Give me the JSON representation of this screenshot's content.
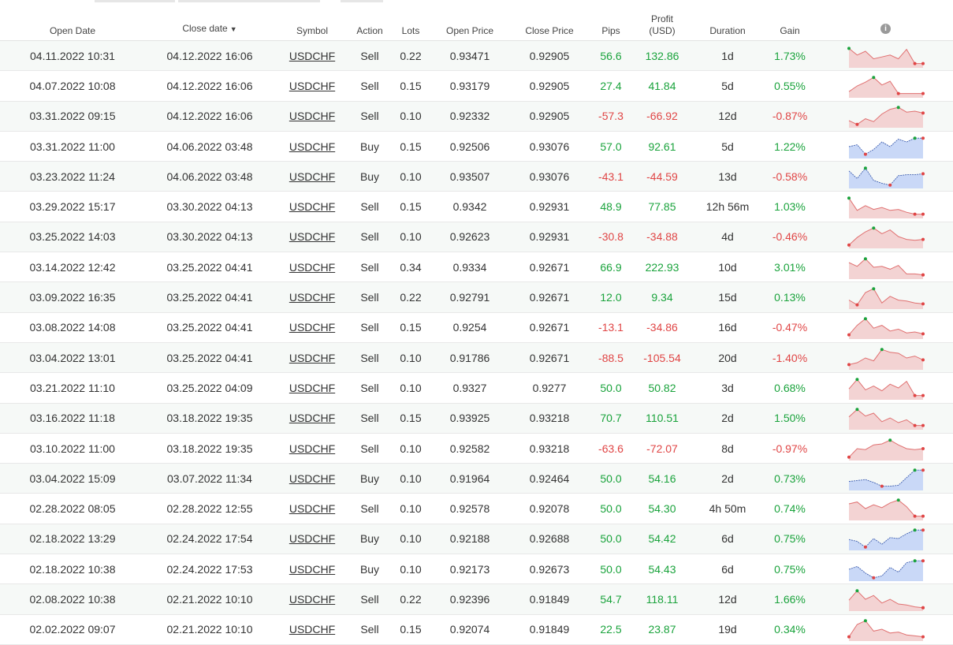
{
  "headers": {
    "open_date": "Open Date",
    "close_date": "Close date",
    "sort_arrow": "▼",
    "symbol": "Symbol",
    "action": "Action",
    "lots": "Lots",
    "open_price": "Open Price",
    "close_price": "Close Price",
    "pips": "Pips",
    "profit_line1": "Profit",
    "profit_line2": "(USD)",
    "duration": "Duration",
    "gain": "Gain",
    "info_glyph": "i"
  },
  "colors": {
    "positive": "#1aa33c",
    "negative": "#e04545",
    "sell_fill": "#f3d3d3",
    "sell_line": "#e07070",
    "buy_fill": "#c9d8f7",
    "buy_line": "#4060b0"
  },
  "rows": [
    {
      "open": "04.11.2022 10:31",
      "close": "04.12.2022 16:06",
      "symbol": "USDCHF",
      "action": "Sell",
      "lots": "0.22",
      "open_price": "0.93471",
      "close_price": "0.92905",
      "pips": "56.6",
      "profit": "132.86",
      "duration": "1d",
      "gain": "1.73%",
      "spark": [
        0.9,
        0.55,
        0.75,
        0.35,
        0.45,
        0.55,
        0.35,
        0.85,
        0.1,
        0.1
      ]
    },
    {
      "open": "04.07.2022 10:08",
      "close": "04.12.2022 16:06",
      "symbol": "USDCHF",
      "action": "Sell",
      "lots": "0.15",
      "open_price": "0.93179",
      "close_price": "0.92905",
      "pips": "27.4",
      "profit": "41.84",
      "duration": "5d",
      "gain": "0.55%",
      "spark": [
        0.2,
        0.5,
        0.7,
        0.95,
        0.55,
        0.75,
        0.1,
        0.1,
        0.1,
        0.1
      ]
    },
    {
      "open": "03.31.2022 09:15",
      "close": "04.12.2022 16:06",
      "symbol": "USDCHF",
      "action": "Sell",
      "lots": "0.10",
      "open_price": "0.92332",
      "close_price": "0.92905",
      "pips": "-57.3",
      "profit": "-66.92",
      "duration": "12d",
      "gain": "-0.87%",
      "spark": [
        0.25,
        0.05,
        0.35,
        0.2,
        0.6,
        0.85,
        0.95,
        0.7,
        0.75,
        0.65
      ]
    },
    {
      "open": "03.31.2022 11:00",
      "close": "04.06.2022 03:48",
      "symbol": "USDCHF",
      "action": "Buy",
      "lots": "0.15",
      "open_price": "0.92506",
      "close_price": "0.93076",
      "pips": "57.0",
      "profit": "92.61",
      "duration": "5d",
      "gain": "1.22%",
      "spark": [
        0.5,
        0.6,
        0.1,
        0.35,
        0.75,
        0.5,
        0.9,
        0.75,
        0.95,
        0.95
      ]
    },
    {
      "open": "03.23.2022 11:24",
      "close": "04.06.2022 03:48",
      "symbol": "USDCHF",
      "action": "Buy",
      "lots": "0.10",
      "open_price": "0.93507",
      "close_price": "0.93076",
      "pips": "-43.1",
      "profit": "-44.59",
      "duration": "13d",
      "gain": "-0.58%",
      "spark": [
        0.8,
        0.4,
        0.95,
        0.3,
        0.15,
        0.05,
        0.55,
        0.6,
        0.6,
        0.65
      ]
    },
    {
      "open": "03.29.2022 15:17",
      "close": "03.30.2022 04:13",
      "symbol": "USDCHF",
      "action": "Sell",
      "lots": "0.15",
      "open_price": "0.9342",
      "close_price": "0.92931",
      "pips": "48.9",
      "profit": "77.85",
      "duration": "12h 56m",
      "gain": "1.03%",
      "spark": [
        0.95,
        0.3,
        0.55,
        0.35,
        0.45,
        0.3,
        0.35,
        0.2,
        0.1,
        0.1
      ]
    },
    {
      "open": "03.25.2022 14:03",
      "close": "03.30.2022 04:13",
      "symbol": "USDCHF",
      "action": "Sell",
      "lots": "0.10",
      "open_price": "0.92623",
      "close_price": "0.92931",
      "pips": "-30.8",
      "profit": "-34.88",
      "duration": "4d",
      "gain": "-0.46%",
      "spark": [
        0.05,
        0.45,
        0.75,
        0.95,
        0.65,
        0.85,
        0.5,
        0.35,
        0.3,
        0.35
      ]
    },
    {
      "open": "03.14.2022 12:42",
      "close": "03.25.2022 04:41",
      "symbol": "USDCHF",
      "action": "Sell",
      "lots": "0.34",
      "open_price": "0.9334",
      "close_price": "0.92671",
      "pips": "66.9",
      "profit": "222.93",
      "duration": "10d",
      "gain": "3.01%",
      "spark": [
        0.75,
        0.55,
        0.95,
        0.5,
        0.55,
        0.4,
        0.6,
        0.15,
        0.15,
        0.1
      ]
    },
    {
      "open": "03.09.2022 16:35",
      "close": "03.25.2022 04:41",
      "symbol": "USDCHF",
      "action": "Sell",
      "lots": "0.22",
      "open_price": "0.92791",
      "close_price": "0.92671",
      "pips": "12.0",
      "profit": "9.34",
      "duration": "15d",
      "gain": "0.13%",
      "spark": [
        0.35,
        0.1,
        0.75,
        0.95,
        0.2,
        0.55,
        0.35,
        0.3,
        0.2,
        0.15
      ]
    },
    {
      "open": "03.08.2022 14:08",
      "close": "03.25.2022 04:41",
      "symbol": "USDCHF",
      "action": "Sell",
      "lots": "0.15",
      "open_price": "0.9254",
      "close_price": "0.92671",
      "pips": "-13.1",
      "profit": "-34.86",
      "duration": "16d",
      "gain": "-0.47%",
      "spark": [
        0.1,
        0.6,
        0.95,
        0.45,
        0.6,
        0.3,
        0.4,
        0.2,
        0.25,
        0.15
      ]
    },
    {
      "open": "03.04.2022 13:01",
      "close": "03.25.2022 04:41",
      "symbol": "USDCHF",
      "action": "Sell",
      "lots": "0.10",
      "open_price": "0.91786",
      "close_price": "0.92671",
      "pips": "-88.5",
      "profit": "-105.54",
      "duration": "20d",
      "gain": "-1.40%",
      "spark": [
        0.15,
        0.25,
        0.5,
        0.35,
        0.95,
        0.8,
        0.75,
        0.5,
        0.6,
        0.4
      ]
    },
    {
      "open": "03.21.2022 11:10",
      "close": "03.25.2022 04:09",
      "symbol": "USDCHF",
      "action": "Sell",
      "lots": "0.10",
      "open_price": "0.9327",
      "close_price": "0.9277",
      "pips": "50.0",
      "profit": "50.82",
      "duration": "3d",
      "gain": "0.68%",
      "spark": [
        0.45,
        0.95,
        0.4,
        0.6,
        0.35,
        0.7,
        0.5,
        0.85,
        0.1,
        0.1
      ]
    },
    {
      "open": "03.16.2022 11:18",
      "close": "03.18.2022 19:35",
      "symbol": "USDCHF",
      "action": "Sell",
      "lots": "0.15",
      "open_price": "0.93925",
      "close_price": "0.93218",
      "pips": "70.7",
      "profit": "110.51",
      "duration": "2d",
      "gain": "1.50%",
      "spark": [
        0.55,
        0.95,
        0.6,
        0.75,
        0.3,
        0.5,
        0.25,
        0.4,
        0.1,
        0.1
      ]
    },
    {
      "open": "03.10.2022 11:00",
      "close": "03.18.2022 19:35",
      "symbol": "USDCHF",
      "action": "Sell",
      "lots": "0.10",
      "open_price": "0.92582",
      "close_price": "0.93218",
      "pips": "-63.6",
      "profit": "-72.07",
      "duration": "8d",
      "gain": "-0.97%",
      "spark": [
        0.05,
        0.5,
        0.45,
        0.7,
        0.75,
        0.95,
        0.7,
        0.5,
        0.45,
        0.5
      ]
    },
    {
      "open": "03.04.2022 15:09",
      "close": "03.07.2022 11:34",
      "symbol": "USDCHF",
      "action": "Buy",
      "lots": "0.10",
      "open_price": "0.91964",
      "close_price": "0.92464",
      "pips": "50.0",
      "profit": "54.16",
      "duration": "2d",
      "gain": "0.73%",
      "spark": [
        0.35,
        0.4,
        0.45,
        0.3,
        0.1,
        0.1,
        0.15,
        0.55,
        0.95,
        0.95
      ]
    },
    {
      "open": "02.28.2022 08:05",
      "close": "02.28.2022 12:55",
      "symbol": "USDCHF",
      "action": "Sell",
      "lots": "0.10",
      "open_price": "0.92578",
      "close_price": "0.92078",
      "pips": "50.0",
      "profit": "54.30",
      "duration": "4h 50m",
      "gain": "0.74%",
      "spark": [
        0.75,
        0.85,
        0.5,
        0.7,
        0.55,
        0.8,
        0.95,
        0.6,
        0.1,
        0.1
      ]
    },
    {
      "open": "02.18.2022 13:29",
      "close": "02.24.2022 17:54",
      "symbol": "USDCHF",
      "action": "Buy",
      "lots": "0.10",
      "open_price": "0.92188",
      "close_price": "0.92688",
      "pips": "50.0",
      "profit": "54.42",
      "duration": "6d",
      "gain": "0.75%",
      "spark": [
        0.45,
        0.35,
        0.05,
        0.5,
        0.2,
        0.55,
        0.5,
        0.75,
        0.95,
        0.95
      ]
    },
    {
      "open": "02.18.2022 10:38",
      "close": "02.24.2022 17:53",
      "symbol": "USDCHF",
      "action": "Buy",
      "lots": "0.10",
      "open_price": "0.92173",
      "close_price": "0.92673",
      "pips": "50.0",
      "profit": "54.43",
      "duration": "6d",
      "gain": "0.75%",
      "spark": [
        0.5,
        0.65,
        0.3,
        0.05,
        0.15,
        0.6,
        0.35,
        0.85,
        0.95,
        0.95
      ]
    },
    {
      "open": "02.08.2022 10:38",
      "close": "02.21.2022 10:10",
      "symbol": "USDCHF",
      "action": "Sell",
      "lots": "0.22",
      "open_price": "0.92396",
      "close_price": "0.91849",
      "pips": "54.7",
      "profit": "118.11",
      "duration": "12d",
      "gain": "1.66%",
      "spark": [
        0.45,
        0.95,
        0.5,
        0.7,
        0.3,
        0.5,
        0.25,
        0.2,
        0.1,
        0.05
      ]
    },
    {
      "open": "02.02.2022 09:07",
      "close": "02.21.2022 10:10",
      "symbol": "USDCHF",
      "action": "Sell",
      "lots": "0.15",
      "open_price": "0.92074",
      "close_price": "0.91849",
      "pips": "22.5",
      "profit": "23.87",
      "duration": "19d",
      "gain": "0.34%",
      "spark": [
        0.1,
        0.75,
        0.95,
        0.4,
        0.5,
        0.3,
        0.35,
        0.2,
        0.15,
        0.1
      ]
    }
  ]
}
